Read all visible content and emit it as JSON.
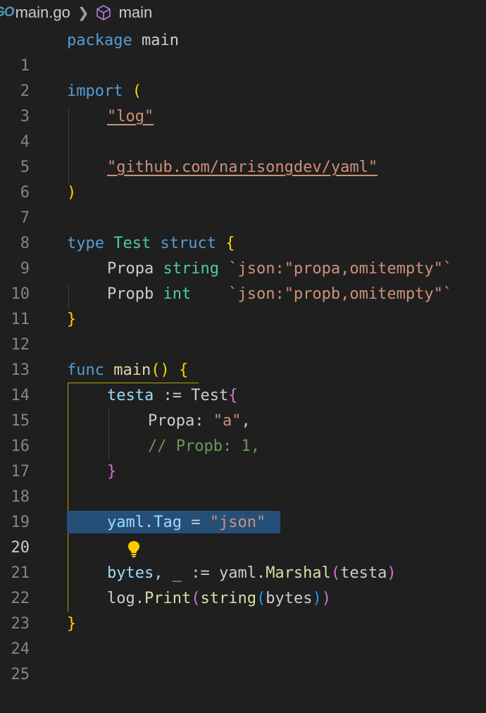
{
  "breadcrumb": {
    "lang_icon": "GO",
    "file": "main.go",
    "separator_icon": "chevron-right-icon",
    "symbol_icon": "cube-icon",
    "symbol": "main"
  },
  "editor": {
    "active_line": 20,
    "line_numbers": [
      "1",
      "2",
      "3",
      "4",
      "5",
      "6",
      "7",
      "8",
      "9",
      "10",
      "11",
      "12",
      "13",
      "14",
      "15",
      "16",
      "17",
      "18",
      "19",
      "20",
      "21",
      "22",
      "23",
      "24",
      "25"
    ],
    "lines": {
      "l1": {
        "kw": "package",
        "rest": " main"
      },
      "l3": {
        "kw": "import",
        "rest": " ",
        "paren": "("
      },
      "l4": {
        "q1": "\"",
        "path": "log",
        "q2": "\""
      },
      "l6": {
        "q1": "\"",
        "path": "github.com/narisongdev/yaml",
        "q2": "\""
      },
      "l7": {
        "paren": ")"
      },
      "l9": {
        "kw": "type",
        "sp1": " ",
        "name": "Test",
        "sp2": " ",
        "kw2": "struct",
        "sp3": " ",
        "brace": "{"
      },
      "l10": {
        "field": "Propa",
        "sp": " ",
        "type": "string",
        "pad": " ",
        "tag": "`json:\"propa,omitempty\"`"
      },
      "l11": {
        "field": "Propb",
        "sp": " ",
        "type": "int",
        "pad": "    ",
        "tag": "`json:\"propb,omitempty\"`"
      },
      "l12": {
        "brace": "}"
      },
      "l14": {
        "kw": "func",
        "sp": " ",
        "name": "main",
        "paren": "()",
        "sp2": " ",
        "brace": "{"
      },
      "l15": {
        "var": "testa",
        "op": " := ",
        "type": "Test",
        "brace": "{"
      },
      "l16": {
        "key": "Propa: ",
        "val": "\"a\"",
        "comma": ","
      },
      "l17": {
        "comment": "// Propb: 1,"
      },
      "l18": {
        "brace": "}"
      },
      "l20": {
        "pkg": "yaml",
        "dot": ".",
        "field": "Tag",
        "op": " = ",
        "val": "\"json\""
      },
      "l22": {
        "var": "bytes",
        "rest": ", _ := ",
        "pkg": "yaml",
        "dot": ".",
        "fn": "Marshal",
        "open": "(",
        "arg": "testa",
        "close": ")"
      },
      "l23": {
        "pkg": "log",
        "dot": ".",
        "fn": "Print",
        "open": "(",
        "fn2": "string",
        "open2": "(",
        "arg": "bytes",
        "close2": ")",
        "close": ")"
      },
      "l24": {
        "brace": "}"
      }
    },
    "lightbulb_icon": "lightbulb-icon"
  }
}
